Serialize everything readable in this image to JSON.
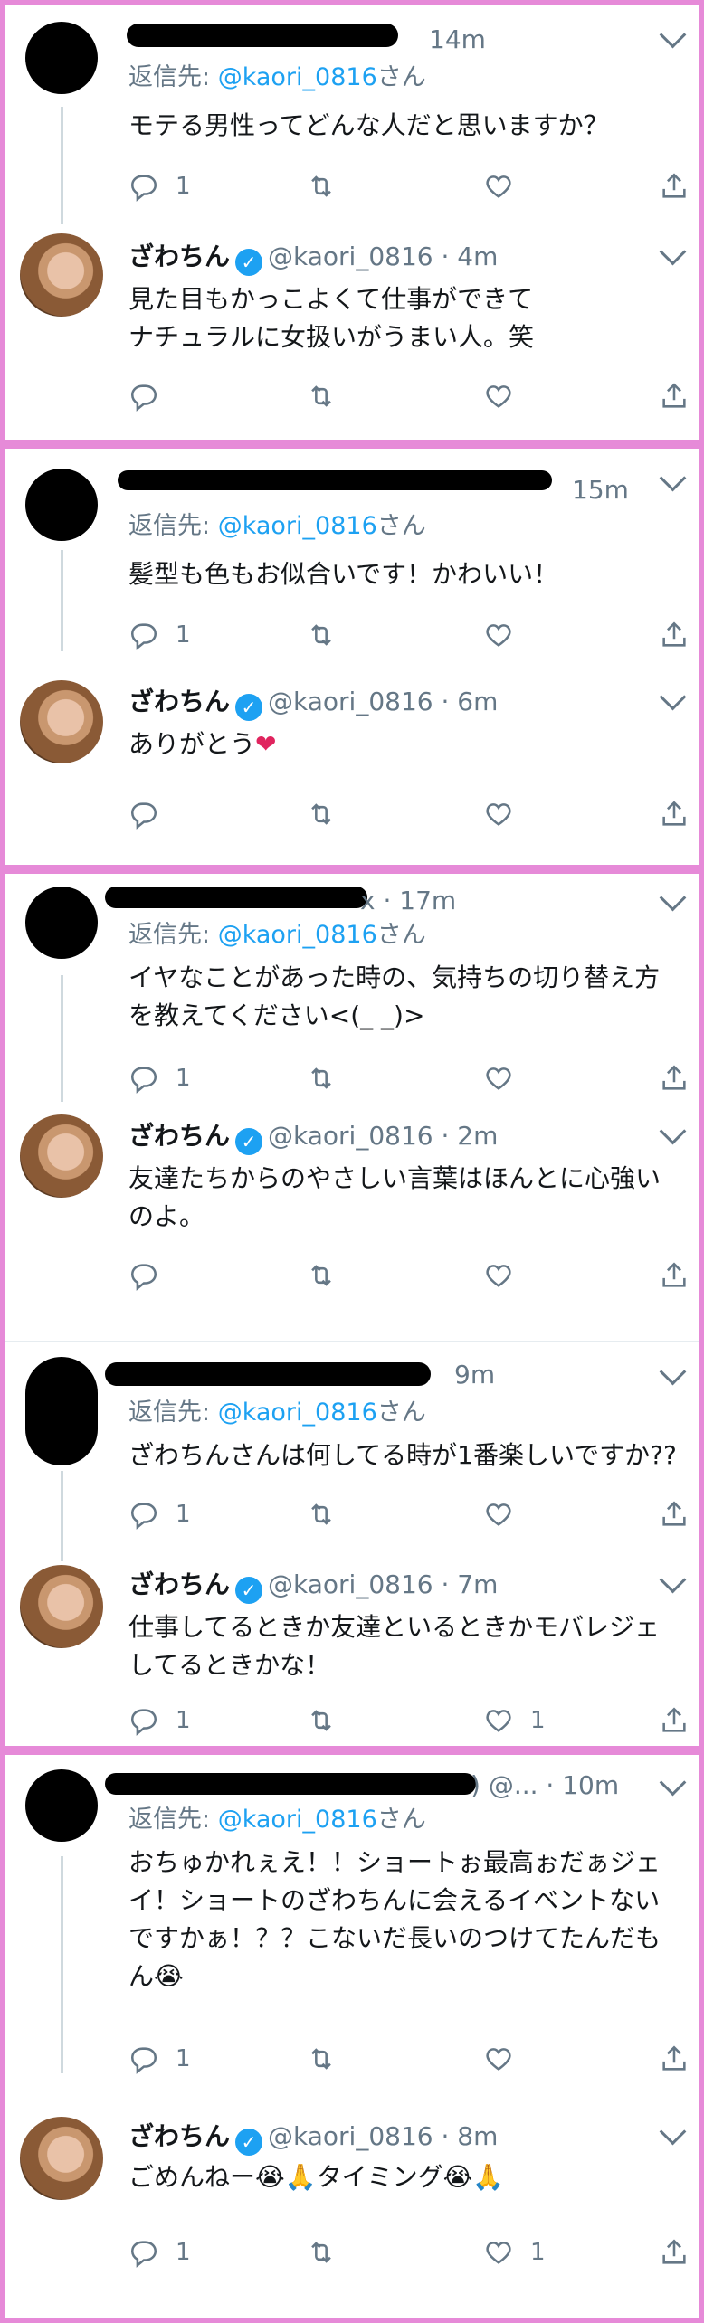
{
  "icons": {
    "reply": "reply-icon",
    "retweet": "retweet-icon",
    "like": "heart-icon",
    "share": "share-icon",
    "more": "chevron-down-icon",
    "verified": "verified-badge-icon"
  },
  "colors": {
    "accent": "#1da1f2",
    "muted": "#657786",
    "border": "#e68ad8"
  },
  "reply_prefix": "返信先:",
  "reply_mention": "@kaori_0816",
  "reply_suffix": "さん",
  "author": {
    "name": "ざわちん",
    "handle": "@kaori_0816",
    "verified_glyph": "✓"
  },
  "threads": [
    {
      "question": {
        "header_tail": "14m",
        "text": "モテる男性ってどんな人だと思いますか？",
        "reply_count": "1",
        "like_count": ""
      },
      "answer": {
        "time": "4m",
        "text": "見た目もかっこよくて仕事ができて\nナチュラルに女扱いがうまい人。笑",
        "reply_count": "",
        "like_count": ""
      }
    },
    {
      "question": {
        "header_tail": "15m",
        "text": "髪型も色もお似合いです！かわいい！",
        "reply_count": "1",
        "like_count": ""
      },
      "answer": {
        "time": "6m",
        "text": "ありがとう",
        "emoji": "❤",
        "reply_count": "",
        "like_count": ""
      }
    },
    {
      "question": {
        "header_tail": "x · 17m",
        "text": "イヤなことがあった時の、気持ちの切り替え方\nを教えてください<(_ _)>",
        "reply_count": "1",
        "like_count": ""
      },
      "answer": {
        "time": "2m",
        "text": "友達たちからのやさしい言葉はほんとに心強い\nのよ。",
        "reply_count": "",
        "like_count": ""
      }
    },
    {
      "question": {
        "header_tail": "9m",
        "text": "ざわちんさんは何してる時が1番楽しいですか??",
        "reply_count": "1",
        "like_count": ""
      },
      "answer": {
        "time": "7m",
        "text": "仕事してるときか友達といるときかモバレジェ\nしてるときかな！",
        "reply_count": "1",
        "like_count": "1"
      }
    },
    {
      "question": {
        "header_tail": ") @... · 10m",
        "text": "おちゅかれぇえ！！ショートぉ最高ぉだぁジェ\nイ！ショートのざわちんに会えるイベントない\nですかぁ！？？こないだ長いのつけてたんだも\nん😭",
        "reply_count": "1",
        "like_count": ""
      },
      "answer": {
        "time": "8m",
        "text": "ごめんねー😭🙏タイミング😭🙏",
        "reply_count": "1",
        "like_count": "1"
      }
    }
  ]
}
